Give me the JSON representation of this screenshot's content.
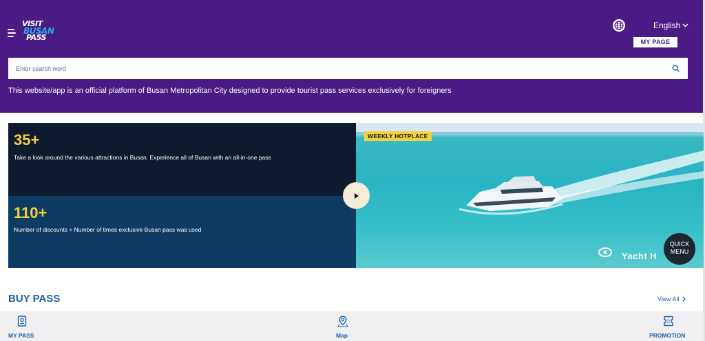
{
  "header": {
    "logo": {
      "line1": "VISIT",
      "line2": "BUSAN",
      "line3": "PASS"
    },
    "language": "English",
    "my_page_label": "MY PAGE",
    "search_placeholder": "Enter search word",
    "notice": "This website/app is an official platform of Busan Metropolitan City designed to provide tourist pass services exclusively for foreigners"
  },
  "stats": [
    {
      "value": "35+",
      "description": "Take a look around the various attractions in Busan. Experience all of Busan with an all-in-one pass"
    },
    {
      "value": "110+",
      "description": "Number of discounts + Number of times exclusive Busan pass was used"
    }
  ],
  "hero": {
    "badge": "WEEKLY HOTPLACE",
    "caption": "Yacht H"
  },
  "quick_menu": {
    "line1": "QUICK",
    "line2": "MENU"
  },
  "buy_pass": {
    "title": "BUY PASS",
    "view_all": "View All"
  },
  "bottom_nav": [
    {
      "label": "MY PASS",
      "icon": "pass-card-icon"
    },
    {
      "label": "Map",
      "icon": "map-pin-icon"
    },
    {
      "label": "PROMOTION",
      "icon": "ticket-icon"
    }
  ],
  "colors": {
    "header_bg": "#4a1a85",
    "accent_yellow": "#f4d23f",
    "link_blue": "#1e5fa8",
    "stat_dark": "#101a2e",
    "stat_blue": "#0d3b61"
  }
}
